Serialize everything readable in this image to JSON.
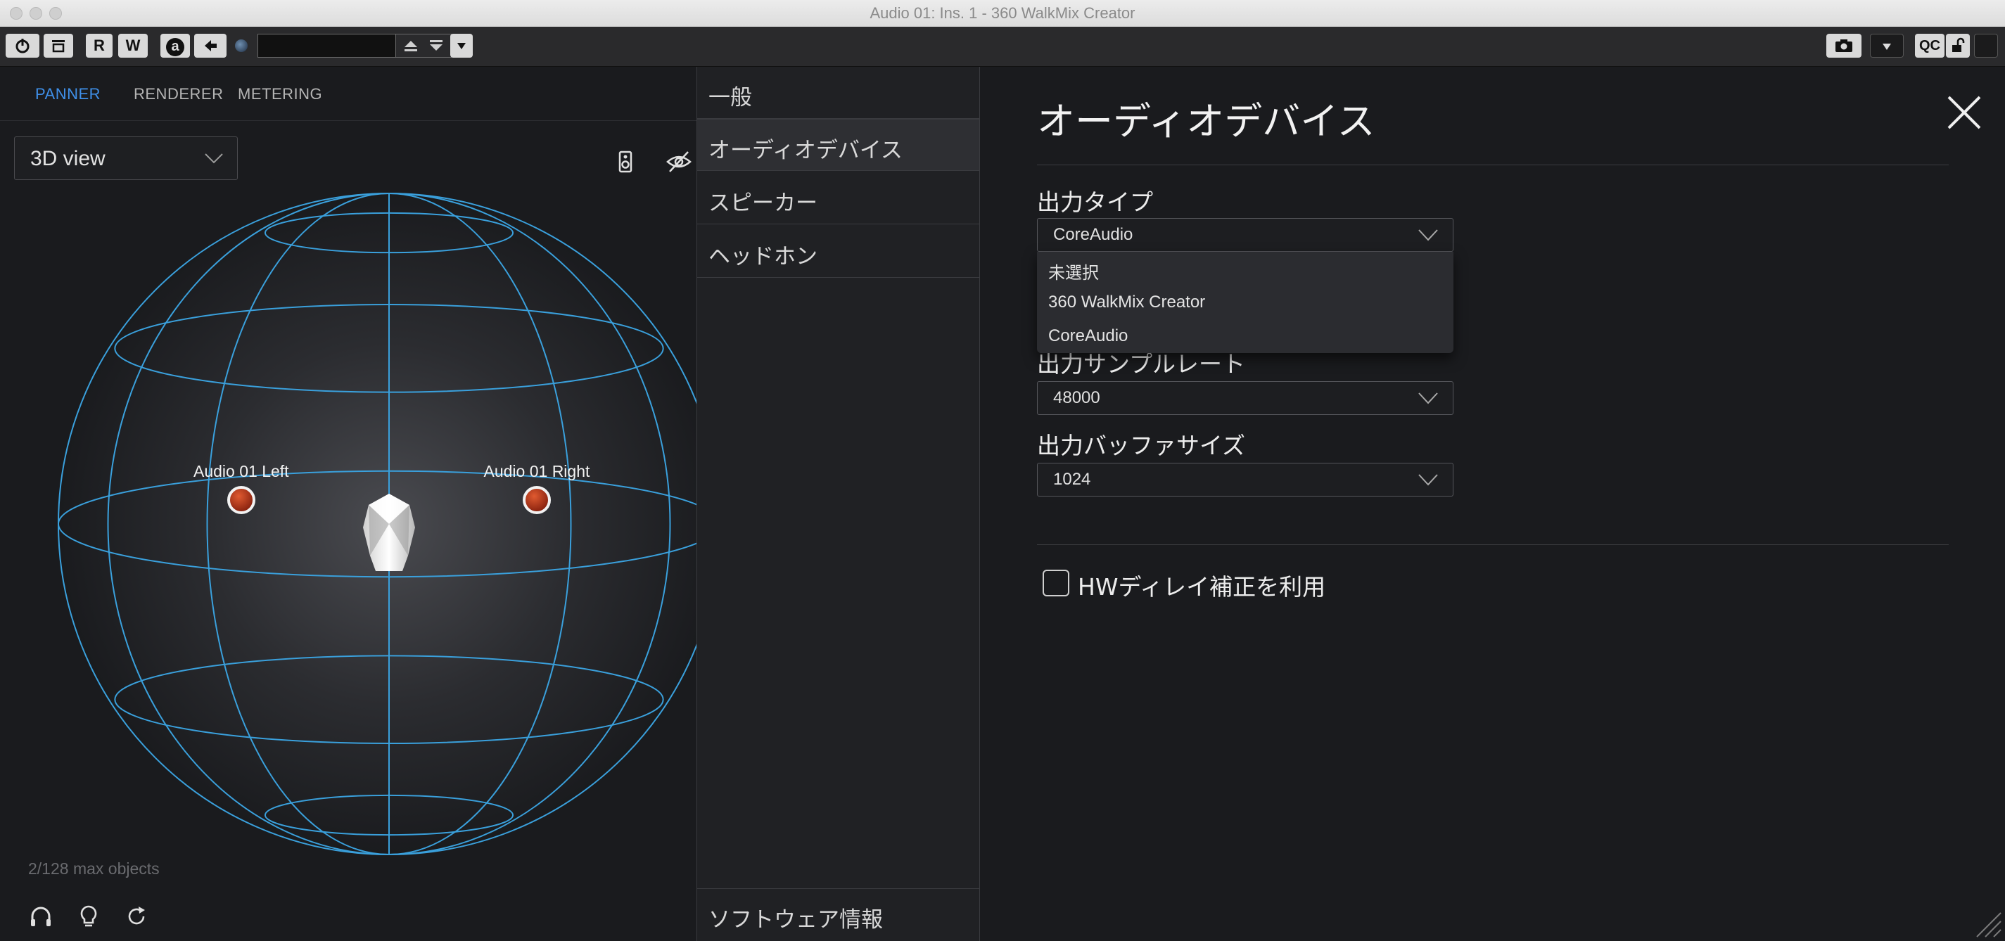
{
  "window": {
    "title": "Audio 01: Ins. 1 - 360 WalkMix Creator"
  },
  "toolbar": {
    "read_label": "R",
    "write_label": "W",
    "automation_label": "a",
    "qc_label": "QC",
    "preset_value": ""
  },
  "panner": {
    "tabs": [
      {
        "label": "PANNER",
        "active": true
      },
      {
        "label": "RENDERER",
        "active": false
      },
      {
        "label": "METERING",
        "active": false
      }
    ],
    "view_select": "3D view",
    "objects": [
      {
        "name": "Audio 01 Left",
        "azimuth_deg": 90,
        "elevation_deg": 0
      },
      {
        "name": "Audio 01 Right",
        "azimuth_deg": -90,
        "elevation_deg": 0
      }
    ],
    "object_count": "2/128 max objects",
    "icons": [
      "speaker-icon",
      "hidden-eye-icon",
      "headphones-icon",
      "lightbulb-icon",
      "reset-icon"
    ],
    "accent_color": "#3f8fe8",
    "wireframe_color": "#3aa0dc",
    "object_color": "#c23a18"
  },
  "settings_menu": {
    "items": [
      {
        "label": "一般",
        "active": false
      },
      {
        "label": "オーディオデバイス",
        "active": true
      },
      {
        "label": "スピーカー",
        "active": false
      },
      {
        "label": "ヘッドホン",
        "active": false
      }
    ],
    "footer_item": "ソフトウェア情報"
  },
  "audio_device": {
    "title": "オーディオデバイス",
    "output_type": {
      "label": "出力タイプ",
      "value": "CoreAudio",
      "options": [
        "未選択",
        "360 WalkMix Creator",
        "CoreAudio"
      ],
      "open": true
    },
    "sample_rate": {
      "label": "出力サンプルレート",
      "value": "48000"
    },
    "buffer_size": {
      "label": "出力バッファサイズ",
      "value": "1024"
    },
    "hw_delay": {
      "label": "HWディレイ補正を利用",
      "checked": false
    }
  }
}
